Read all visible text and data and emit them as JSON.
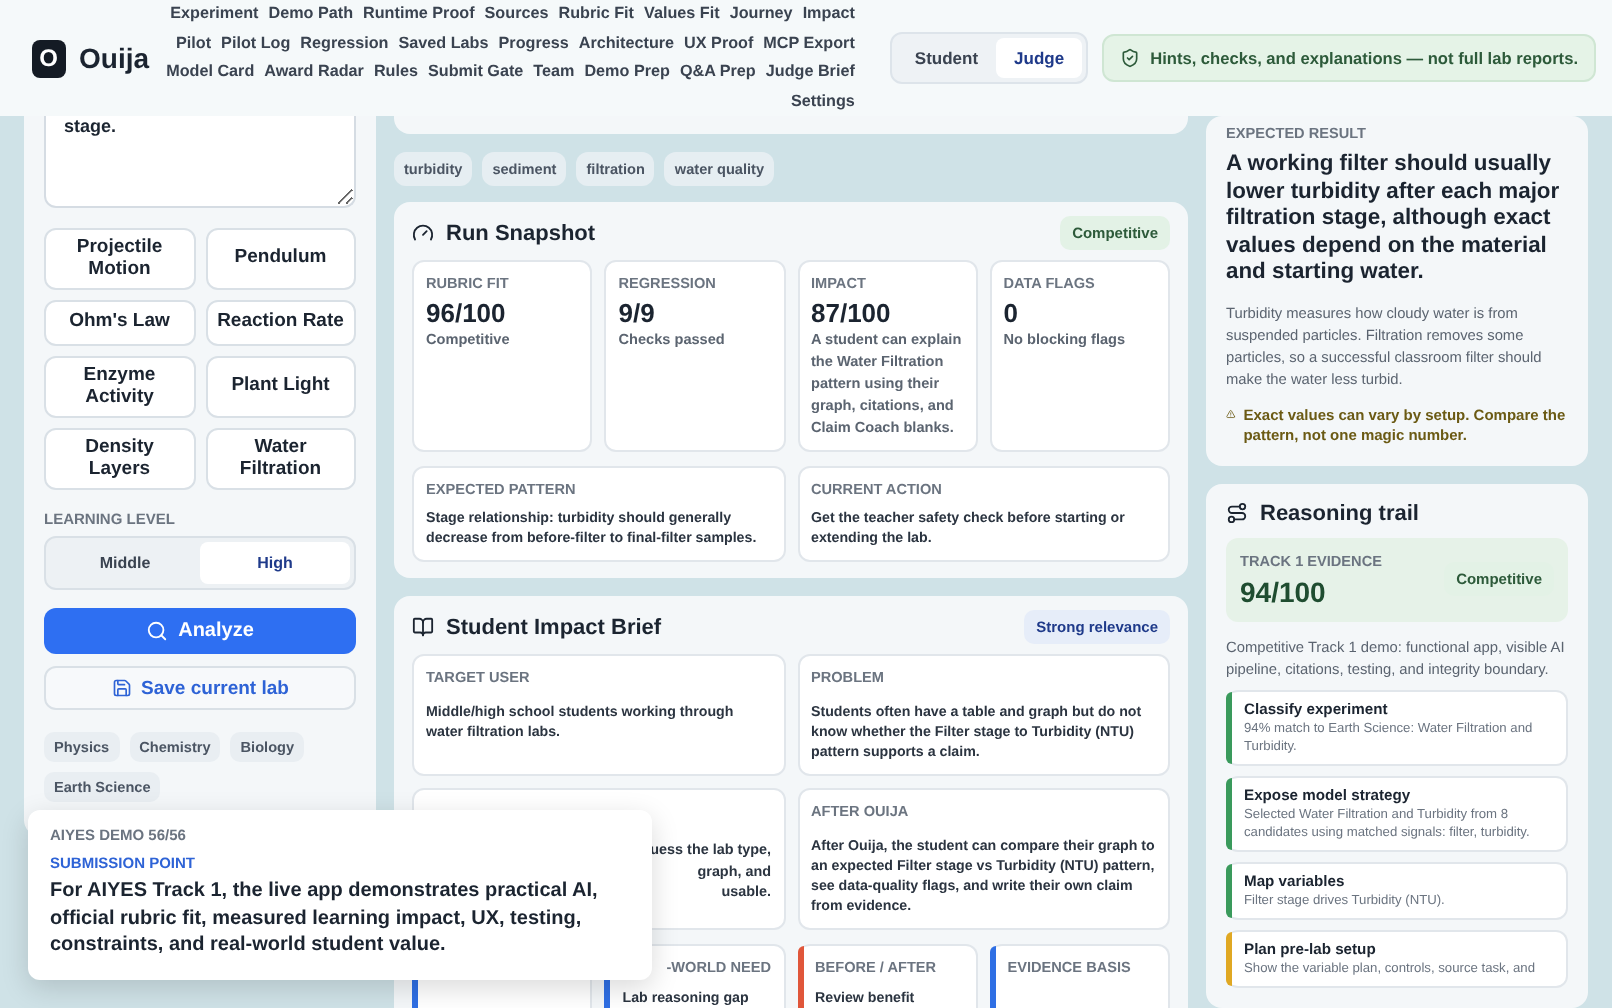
{
  "brand": {
    "mark": "O",
    "name": "Ouija"
  },
  "nav": [
    {
      "links": [
        "Experiment",
        "Demo Path",
        "Runtime Proof",
        "Sources",
        "Rubric Fit",
        "Values Fit",
        "Journey",
        "Impact"
      ]
    },
    {
      "links": [
        "Pilot",
        "Pilot Log",
        "Regression",
        "Saved Labs",
        "Progress",
        "Architecture",
        "UX Proof",
        "MCP Export"
      ]
    },
    {
      "links": [
        "Model Card",
        "Award Radar",
        "Rules",
        "Submit Gate",
        "Team",
        "Demo Prep",
        "Q&A Prep",
        "Judge Brief"
      ]
    },
    {
      "links": [
        "Settings"
      ]
    }
  ],
  "role_toggle": [
    {
      "label": "Student",
      "selected": false
    },
    {
      "label": "Judge",
      "selected": true
    }
  ],
  "notice": "Hints, checks, and explanations — not full lab reports.",
  "lab_input": {
    "value": "stage."
  },
  "labs": [
    "Projectile Motion",
    "Pendulum",
    "Ohm's Law",
    "Reaction Rate",
    "Enzyme Activity",
    "Plant Light",
    "Density Layers",
    "Water Filtration"
  ],
  "learning_level": {
    "label": "LEARNING LEVEL",
    "options": [
      {
        "label": "Middle",
        "selected": false
      },
      {
        "label": "High",
        "selected": true
      }
    ]
  },
  "analyze_button": "Analyze",
  "save_button": "Save current lab",
  "subjects": [
    "Physics",
    "Chemistry",
    "Biology",
    "Earth Science"
  ],
  "popup": {
    "eyebrow": "AIYES DEMO 56/56",
    "label": "SUBMISSION POINT",
    "text": "For AIYES Track 1, the live app demonstrates practical AI, official rubric fit, measured learning impact, UX, testing, constraints, and real-world student value."
  },
  "keywords": [
    "turbidity",
    "sediment",
    "filtration",
    "water quality"
  ],
  "run_snapshot": {
    "title": "Run Snapshot",
    "badge": {
      "text": "Competitive"
    },
    "metrics": [
      {
        "label": "RUBRIC FIT",
        "value": "96/100",
        "note": "Competitive"
      },
      {
        "label": "REGRESSION",
        "value": "9/9",
        "note": "Checks passed"
      },
      {
        "label": "IMPACT",
        "value": "87/100",
        "note": "A student can explain the Water Filtration pattern using their graph, citations, and Claim Coach blanks."
      },
      {
        "label": "DATA FLAGS",
        "value": "0",
        "note": "No blocking flags"
      }
    ],
    "details": [
      {
        "label": "EXPECTED PATTERN",
        "text": "Stage relationship: turbidity should generally decrease from before-filter to final-filter samples."
      },
      {
        "label": "CURRENT ACTION",
        "text": "Get the teacher safety check before starting or extending the lab."
      }
    ]
  },
  "impact_brief": {
    "title": "Student Impact Brief",
    "badge": {
      "text": "Strong relevance"
    },
    "cards": [
      {
        "label": "TARGET USER",
        "lines": [
          "Middle/high school students working through water filtration labs."
        ]
      },
      {
        "label": "PROBLEM",
        "lines": [
          "Students often have a table and graph but do not know whether the Filter stage to Turbidity (NTU) pattern supports a claim."
        ]
      },
      {
        "lines": [
          "uess the lab type,",
          "graph, and",
          "usable."
        ]
      },
      {
        "label": "AFTER OUIJA",
        "lines": [
          "After Ouija, the student can compare their graph to an expected Filter stage vs Turbidity (NTU) pattern, see data-quality flags, and write their own claim from evidence."
        ]
      }
    ],
    "highlights": [
      {
        "color": "#2f6fe4"
      },
      {
        "label": "-WORLD NEED",
        "text": "Lab reasoning gap",
        "color": "#2f6fe4"
      },
      {
        "label": "BEFORE / AFTER",
        "text": "Review benefit",
        "color": "#e0563a"
      },
      {
        "label": "EVIDENCE BASIS",
        "color": "#2f6fe4"
      }
    ]
  },
  "expected_result": {
    "label": "EXPECTED RESULT",
    "headline": "A working filter should usually lower turbidity after each major filtration stage, although exact values depend on the material and starting water.",
    "body": "Turbidity measures how cloudy water is from suspended particles. Filtration removes some particles, so a successful classroom filter should make the water less turbid.",
    "warning": "Exact values can vary by setup. Compare the pattern, not one magic number."
  },
  "reasoning_trail": {
    "title": "Reasoning trail",
    "evidence": {
      "label": "TRACK 1 EVIDENCE",
      "score": "94/100",
      "badge": {
        "text": "Competitive"
      }
    },
    "summary": "Competitive Track 1 demo: functional app, visible AI pipeline, citations, testing, and integrity boundary.",
    "steps": [
      {
        "title": "Classify experiment",
        "text": "94% match to Earth Science: Water Filtration and Turbidity.",
        "color": "#3a9a5c"
      },
      {
        "title": "Expose model strategy",
        "text": "Selected Water Filtration and Turbidity from 8 candidates using matched signals: filter, turbidity.",
        "color": "#3a9a5c"
      },
      {
        "title": "Map variables",
        "text": "Filter stage drives Turbidity (NTU).",
        "color": "#3a9a5c"
      },
      {
        "title": "Plan pre-lab setup",
        "text": "Show the variable plan, controls, source task, and",
        "color": "#e0a823"
      }
    ]
  }
}
